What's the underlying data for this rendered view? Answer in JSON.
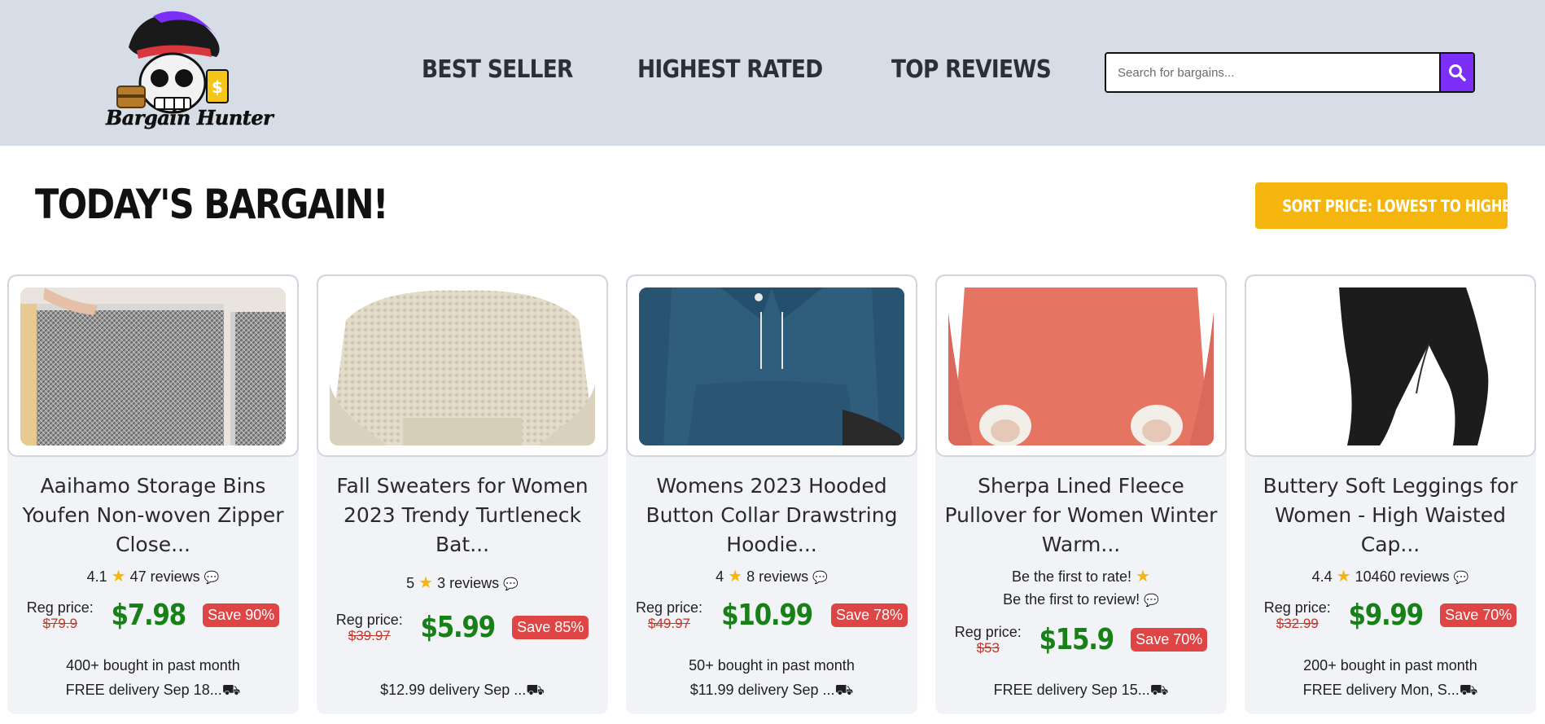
{
  "header": {
    "logo_text": "Bargain Hunter",
    "nav": [
      "BEST SELLER",
      "HIGHEST RATED",
      "TOP REVIEWS"
    ],
    "search_placeholder": "Search for bargains...",
    "accent_color": "#7b2ff7",
    "background_color": "#d6dde6"
  },
  "main": {
    "title": "TODAY'S BARGAIN!",
    "sort_label": "SORT PRICE: LOWEST TO HIGHEST",
    "sort_color": "#f5b50f"
  },
  "products": [
    {
      "title": "Aaihamo Storage Bins Youfen Non-woven Zipper Close...",
      "rating_value": "4.1",
      "reviews": "47 reviews",
      "reg_label": "Reg price:",
      "reg_price": "$79.9",
      "price": "$7.98",
      "save": "Save 90%",
      "bought": "400+ bought in past month",
      "delivery": "FREE delivery Sep 18...",
      "image": "storage-bin"
    },
    {
      "title": "Fall Sweaters for Women 2023 Trendy Turtleneck Bat...",
      "rating_value": "5",
      "reviews": "3 reviews",
      "reg_label": "Reg price:",
      "reg_price": "$39.97",
      "price": "$5.99",
      "save": "Save 85%",
      "bought": "",
      "delivery": "$12.99 delivery Sep ...",
      "image": "cream-sweater"
    },
    {
      "title": "Womens 2023 Hooded Button Collar Drawstring Hoodie...",
      "rating_value": "4",
      "reviews": "8 reviews",
      "reg_label": "Reg price:",
      "reg_price": "$49.97",
      "price": "$10.99",
      "save": "Save 78%",
      "bought": "50+ bought in past month",
      "delivery": "$11.99 delivery Sep ...",
      "image": "blue-hoodie"
    },
    {
      "title": "Sherpa Lined Fleece Pullover for Women Winter Warm...",
      "rating_value": "Be the first to rate!",
      "reviews": "Be the first to review!",
      "reg_label": "Reg price:",
      "reg_price": "$53",
      "price": "$15.9",
      "save": "Save 70%",
      "bought": "",
      "delivery": "FREE delivery Sep 15...",
      "image": "coral-pullover"
    },
    {
      "title": "Buttery Soft Leggings for Women - High Waisted Cap...",
      "rating_value": "4.4",
      "reviews": "10460 reviews",
      "reg_label": "Reg price:",
      "reg_price": "$32.99",
      "price": "$9.99",
      "save": "Save 70%",
      "bought": "200+ bought in past month",
      "delivery": "FREE delivery Mon, S...",
      "image": "black-leggings"
    }
  ]
}
